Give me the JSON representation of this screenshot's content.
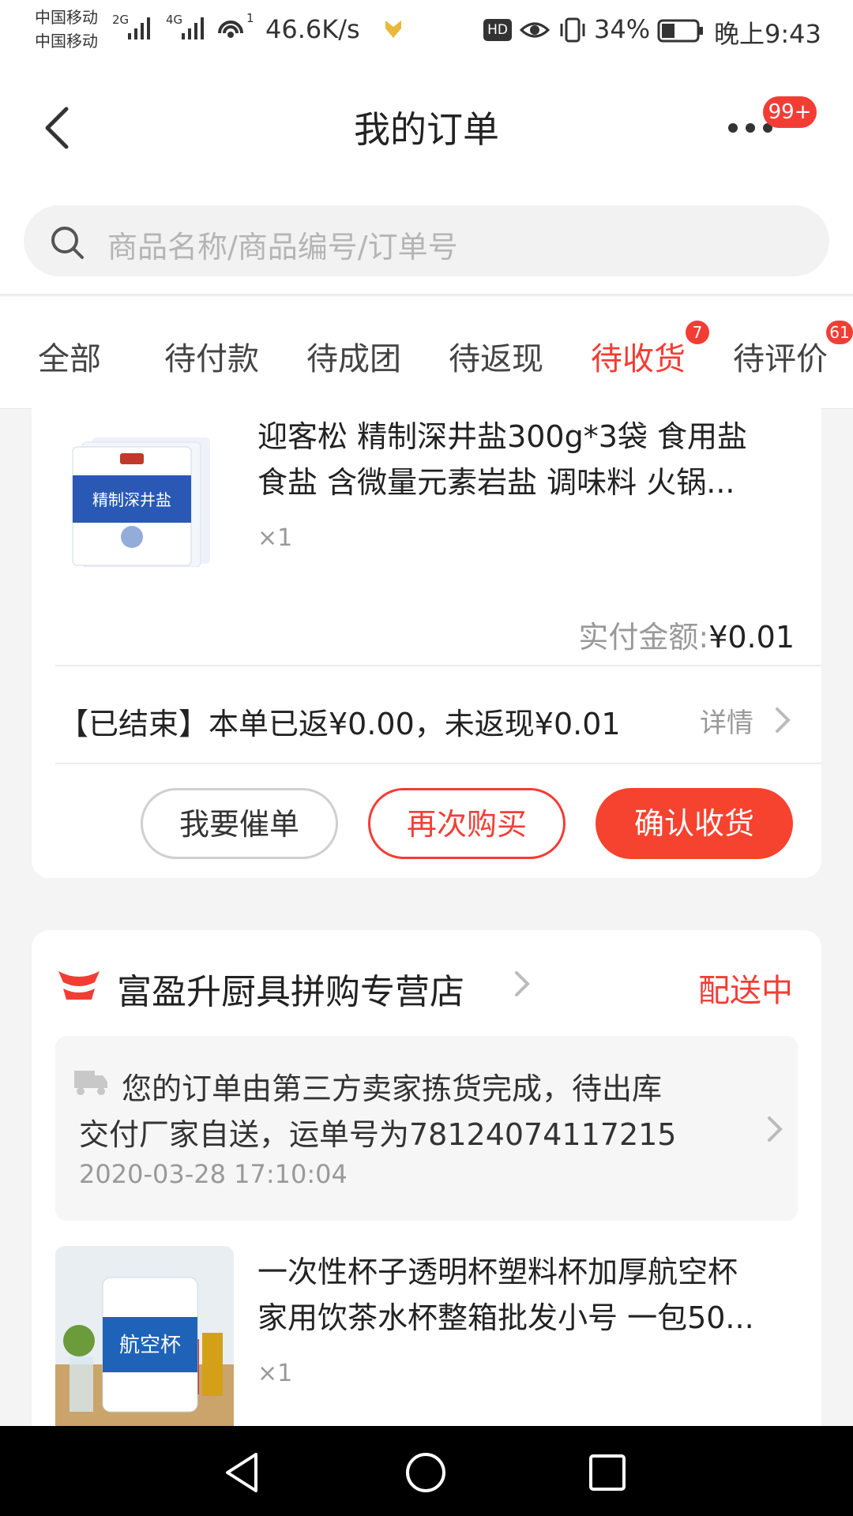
{
  "status_bar": {
    "carrier_1": "中国移动",
    "carrier_2": "中国移动",
    "net_2g": "2G",
    "net_4g": "4G",
    "wifi_num": "1",
    "speed": "46.6K/s",
    "hd": "HD",
    "battery": "34%",
    "time": "晚上9:43"
  },
  "header": {
    "back_icon": "chevron-left-icon",
    "title": "我的订单",
    "more_icon": "more-dots-icon",
    "more_badge": "99+"
  },
  "search": {
    "icon": "search-icon",
    "placeholder": "商品名称/商品编号/订单号"
  },
  "tabs": [
    {
      "label": "全部"
    },
    {
      "label": "待付款"
    },
    {
      "label": "待成团"
    },
    {
      "label": "待返现"
    },
    {
      "label": "待收货",
      "badge": "7",
      "active": true
    },
    {
      "label": "待评价",
      "badge": "61"
    }
  ],
  "order1": {
    "product_title_line1": "迎客松  精制深井盐300g*3袋  食用盐",
    "product_title_line2": "食盐 含微量元素岩盐  调味料 火锅...",
    "product_image_text": "精制深井盐",
    "qty": "×1",
    "paid_label": "实付金额:",
    "paid_amount": "¥0.01",
    "cashback_text": "【已结束】本单已返¥0.00，未返现¥0.01",
    "detail_label": "详情",
    "buttons": {
      "urge": "我要催单",
      "rebuy": "再次购买",
      "confirm": "确认收货"
    }
  },
  "order2": {
    "shop_icon": "shop-logo-icon",
    "shop_name": "富盈升厨具拼购专营店",
    "status": "配送中",
    "logistic_line1": "您的订单由第三方卖家拣货完成，待出库",
    "logistic_line2": "交付厂家自送，运单号为78124074117215",
    "logistic_time": "2020-03-28 17:10:04",
    "product_title_line1": "一次性杯子透明杯塑料杯加厚航空杯",
    "product_title_line2": "家用饮茶水杯整箱批发小号 一包50...",
    "product_image_text": "航空杯",
    "qty": "×1"
  },
  "colors": {
    "accent": "#f23d35",
    "button_fill": "#f5432f",
    "muted": "#999999"
  }
}
